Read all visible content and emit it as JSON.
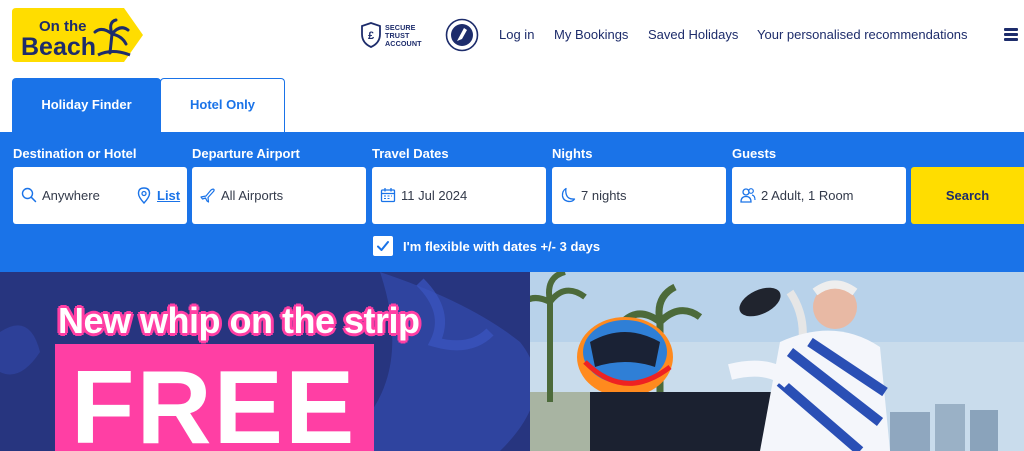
{
  "brand": {
    "logo_text_line1": "On the",
    "logo_text_line2": "Beach"
  },
  "header": {
    "secure_badge": [
      "SECURE",
      "TRUST",
      "ACCOUNT"
    ],
    "nav": {
      "login": "Log in",
      "bookings": "My Bookings",
      "saved": "Saved Holidays",
      "recommendations": "Your personalised recommendations"
    }
  },
  "tabs": [
    {
      "label": "Holiday Finder",
      "active": true
    },
    {
      "label": "Hotel Only",
      "active": false
    }
  ],
  "search": {
    "destination": {
      "label": "Destination or Hotel",
      "value": "Anywhere",
      "list_link": "List"
    },
    "departure": {
      "label": "Departure Airport",
      "value": "All Airports"
    },
    "dates": {
      "label": "Travel Dates",
      "value": "11 Jul 2024"
    },
    "nights": {
      "label": "Nights",
      "value": "7 nights"
    },
    "guests": {
      "label": "Guests",
      "value": "2 Adult, 1 Room"
    },
    "search_button": "Search",
    "flexible": {
      "label": "I'm flexible with dates +/- 3 days",
      "checked": true
    }
  },
  "hero": {
    "headline": "New whip on the strip",
    "big_text": "FREE"
  },
  "colors": {
    "brand_blue": "#1a73e8",
    "navy": "#1d2c6b",
    "yellow": "#ffdd00",
    "pink": "#ff3fa4",
    "hero_bg": "#27357f"
  }
}
